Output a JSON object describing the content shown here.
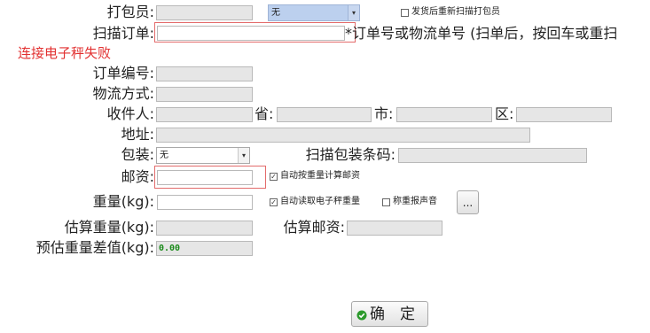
{
  "form": {
    "packer_label": "打包员:",
    "packer_select_value": "无",
    "rescan_checkbox_label": "发货后重新扫描打包员",
    "scan_order_label": "扫描订单:",
    "scan_order_value": "",
    "scan_hint": "*订单号或物流单号 (扫单后，按回车或重扫",
    "error_message": "连接电子秤失败",
    "order_no_label": "订单编号:",
    "shipping_method_label": "物流方式:",
    "recipient_label": "收件人:",
    "province_label": "省:",
    "city_label": "市:",
    "district_label": "区:",
    "address_label": "地址:",
    "package_label": "包装:",
    "package_select_value": "无",
    "scan_package_barcode_label": "扫描包装条码:",
    "postage_label": "邮资:",
    "auto_postage_label": "自动按重量计算邮资",
    "auto_postage_checked": true,
    "weight_label": "重量(kg):",
    "auto_read_scale_label": "自动读取电子秤重量",
    "auto_read_scale_checked": true,
    "weigh_sound_label": "称重报声音",
    "weigh_sound_checked": false,
    "more_button_label": "...",
    "est_weight_label": "估算重量(kg):",
    "est_postage_label": "估算邮资:",
    "weight_diff_label": "预估重量差值(kg):",
    "weight_diff_value": "0.00",
    "confirm_button_label": "确　定"
  },
  "colors": {
    "error_text": "#e23030",
    "highlight_border": "#e36b6b",
    "readonly_field": "#e6e6e6",
    "value_green": "#1a8a1a",
    "selected_option": "#bcd0ee"
  },
  "icons": {
    "confirm": "green-circle-check-icon",
    "dropdown": "chevron-down-icon"
  }
}
